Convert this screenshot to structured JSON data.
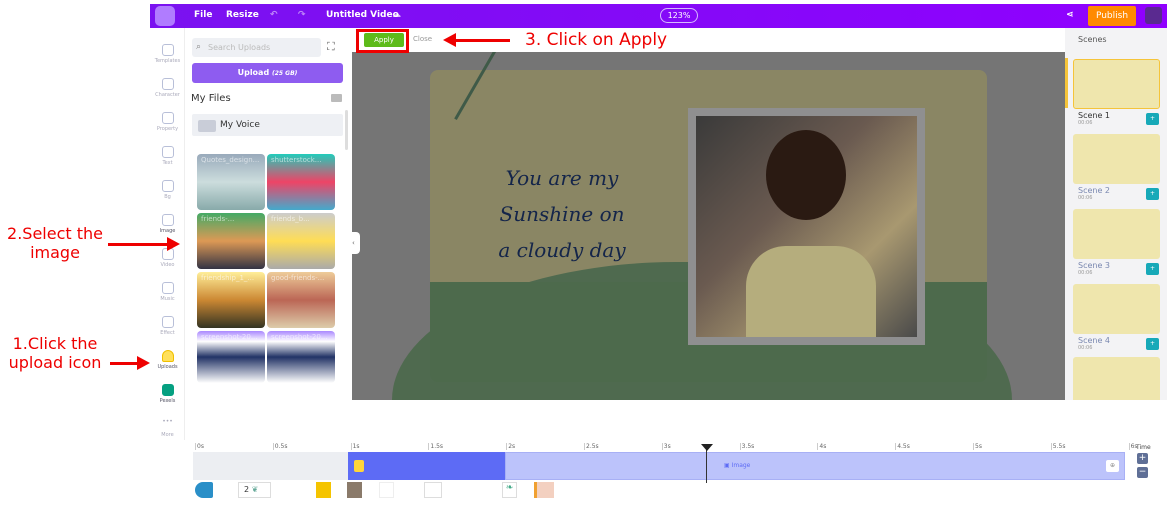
{
  "topbar": {
    "file": "File",
    "resize": "Resize",
    "title": "Untitled Video",
    "zoom": "123%",
    "publish": "Publish"
  },
  "sidebar": {
    "items": [
      {
        "label": "Templates",
        "icon": "templates-icon"
      },
      {
        "label": "Character",
        "icon": "character-icon"
      },
      {
        "label": "Property",
        "icon": "property-icon"
      },
      {
        "label": "Text",
        "icon": "text-icon"
      },
      {
        "label": "Bg",
        "icon": "background-icon"
      },
      {
        "label": "Image",
        "icon": "image-icon"
      },
      {
        "label": "Video",
        "icon": "video-icon"
      },
      {
        "label": "Music",
        "icon": "music-icon"
      },
      {
        "label": "Effect",
        "icon": "effect-icon"
      },
      {
        "label": "Uploads",
        "icon": "cloud-upload-icon"
      },
      {
        "label": "Pexels",
        "icon": "pexels-icon"
      },
      {
        "label": "More",
        "icon": "more-icon"
      }
    ]
  },
  "panel": {
    "search_placeholder": "Search Uploads",
    "upload_label": "Upload",
    "upload_size": "(25 GB)",
    "my_files": "My Files",
    "folder": "My Voice",
    "thumbs": [
      "Quotes_design...",
      "shutterstock...",
      "friends-...",
      "friends_b...",
      "friendship_1_...",
      "good-friends-...",
      "screenshot-20...",
      "screenshot-20..."
    ]
  },
  "toolbar": {
    "apply": "Apply",
    "close": "Close"
  },
  "canvas": {
    "text_lines": [
      "You are my",
      "Sunshine on",
      "a cloudy day"
    ]
  },
  "scenes": {
    "title": "Scenes",
    "items": [
      {
        "name": "Scene 1",
        "time": "00:06"
      },
      {
        "name": "Scene 2",
        "time": "00:06"
      },
      {
        "name": "Scene 3",
        "time": "00:06"
      },
      {
        "name": "Scene 4",
        "time": "00:06"
      }
    ]
  },
  "timeline": {
    "ticks": [
      "0s",
      "0.5s",
      "1s",
      "1.5s",
      "2s",
      "2.5s",
      "3s",
      "3.5s",
      "4s",
      "4.5s",
      "5s",
      "5.5s",
      "6s"
    ],
    "time_label": "Time",
    "clip_label": "Image",
    "layer_count": "2"
  },
  "annotations": {
    "step1": "1.Click the upload icon",
    "step2": "2.Select the image",
    "step3": "3. Click on Apply"
  },
  "colors": {
    "topbar": "#8a00ff",
    "publish": "#ff8a00",
    "apply": "#5dbb1a",
    "annotation": "#e00000"
  }
}
